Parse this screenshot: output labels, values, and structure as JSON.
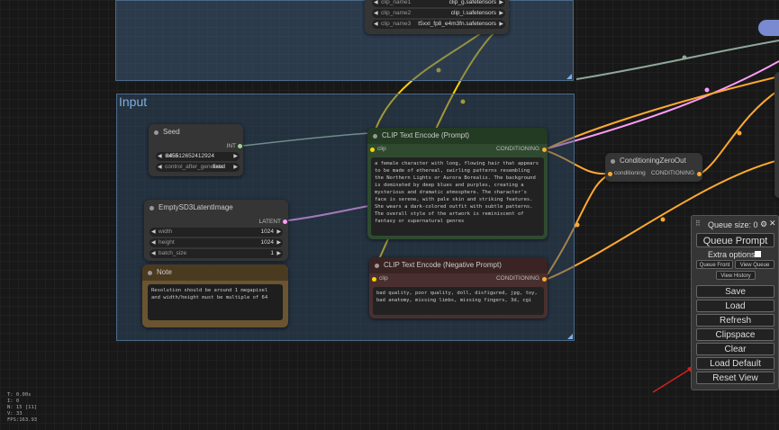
{
  "groups": [
    {
      "title": ""
    },
    {
      "title": "Input"
    }
  ],
  "clip_loader": {
    "widgets": [
      {
        "name": "clip_name1",
        "value": "clip_g.safetensors"
      },
      {
        "name": "clip_name2",
        "value": "clip_l.safetensors"
      },
      {
        "name": "clip_name3",
        "value": "t5xxl_fp8_e4m3fn.safetensors"
      }
    ]
  },
  "seed_node": {
    "title": "Seed",
    "output": "INT",
    "widgets": [
      {
        "name": "value",
        "value": "845512652412924"
      },
      {
        "name": "control_after_generate",
        "value": "fixed"
      }
    ]
  },
  "latent_node": {
    "title": "EmptySD3LatentImage",
    "output": "LATENT",
    "widgets": [
      {
        "name": "width",
        "value": "1024"
      },
      {
        "name": "height",
        "value": "1024"
      },
      {
        "name": "batch_size",
        "value": "1"
      }
    ]
  },
  "note_node": {
    "title": "Note",
    "text": "Resolution should be around 1 megapixel and width/height must be multiple of 64"
  },
  "clip_pos": {
    "title": "CLIP Text Encode (Prompt)",
    "input": "clip",
    "output": "CONDITIONING",
    "text": "a female character with long, flowing hair that appears to be made of ethereal, swirling patterns resembling the Northern Lights or Aurora Borealis. The background is dominated by deep blues and purples, creating a mysterious and dramatic atmosphere. The character's face is serene, with pale skin and striking features. She wears a dark-colored outfit with subtle patterns. The overall style of the artwork is reminiscent of fantasy or supernatural genres"
  },
  "clip_neg": {
    "title": "CLIP Text Encode (Negative Prompt)",
    "input": "clip",
    "output": "CONDITIONING",
    "text": "bad quality, poor quality, doll, disfigured, jpg, toy, bad anatomy, missing limbs, missing fingers, 3d, cgi"
  },
  "zero_out": {
    "title": "ConditioningZeroOut",
    "input": "conditioning",
    "output": "CONDITIONING"
  },
  "menu": {
    "queue_size": "Queue size: 0",
    "queue_prompt": "Queue Prompt",
    "extra_options": "Extra options",
    "queue_front": "Queue Front",
    "view_queue": "View Queue",
    "view_history": "View History",
    "save": "Save",
    "load": "Load",
    "refresh": "Refresh",
    "clipspace": "Clipspace",
    "clear": "Clear",
    "load_default": "Load Default",
    "reset_view": "Reset View"
  },
  "stats": [
    "T: 0.00s",
    "I: 0",
    "N: 15 [11]",
    "V: 33",
    "FPS:163.93"
  ],
  "colors": {
    "group_fill": "#3c5a78",
    "conditioning_wire": "#ffa931",
    "latent_wire": "#ff9cf9",
    "clip_wire": "#ffd500",
    "int_wire": "#a0d0a0",
    "annotation_arrow": "#d42020"
  }
}
